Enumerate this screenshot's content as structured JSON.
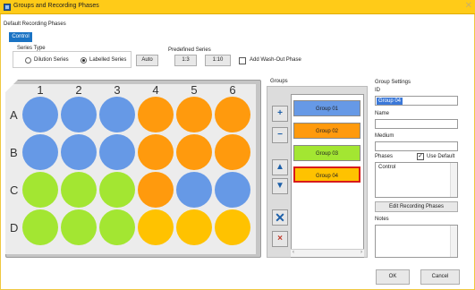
{
  "window": {
    "title": "Groups and Recording Phases",
    "close_glyph": "✕"
  },
  "header": {
    "section_label": "Default Recording Phases",
    "control_tab": "Control"
  },
  "series_type": {
    "title": "Series Type",
    "options": [
      {
        "label": "Dilution Series",
        "selected": false
      },
      {
        "label": "Labelled Series",
        "selected": true
      }
    ],
    "auto_label": "Auto"
  },
  "predefined_series": {
    "title": "Predefined Series",
    "options": [
      "1:3",
      "1:10"
    ]
  },
  "wash_out": {
    "label": "Add Wash-Out Phase",
    "checked": false
  },
  "plate": {
    "columns": [
      "1",
      "2",
      "3",
      "4",
      "5",
      "6"
    ],
    "rows": [
      {
        "label": "A",
        "wells": [
          "#6699e6",
          "#6699e6",
          "#6699e6",
          "#ff9a0d",
          "#ff9a0d",
          "#ff9a0d"
        ]
      },
      {
        "label": "B",
        "wells": [
          "#6699e6",
          "#6699e6",
          "#6699e6",
          "#ff9a0d",
          "#ff9a0d",
          "#ff9a0d"
        ]
      },
      {
        "label": "C",
        "wells": [
          "#a3e632",
          "#a3e632",
          "#a3e632",
          "#ff9a0d",
          "#6699e6",
          "#6699e6"
        ]
      },
      {
        "label": "D",
        "wells": [
          "#a3e632",
          "#a3e632",
          "#a3e632",
          "#ffc200",
          "#ffc200",
          "#ffc200"
        ]
      }
    ]
  },
  "groups": {
    "title": "Groups",
    "items": [
      {
        "label": "Group 01",
        "color": "#6699e6",
        "selected": false
      },
      {
        "label": "Group 02",
        "color": "#ff9a0d",
        "selected": false
      },
      {
        "label": "Group 03",
        "color": "#a3e632",
        "selected": false
      },
      {
        "label": "Group 04",
        "color": "#ffc200",
        "selected": true
      }
    ],
    "tools": [
      "add-group-icon",
      "remove-group-icon",
      "move-up-icon",
      "move-down-icon",
      "clear-wells-icon",
      "delete-group-icon"
    ]
  },
  "group_settings": {
    "title": "Group Settings",
    "id_label": "ID",
    "id_value": "Group 04",
    "name_label": "Name",
    "name_value": "",
    "medium_label": "Medium",
    "medium_value": "",
    "phases_label": "Phases",
    "use_default_label": "Use Default",
    "use_default_checked": true,
    "phases_value": "Control",
    "edit_phases_label": "Edit Recording Phases",
    "notes_label": "Notes",
    "notes_value": ""
  },
  "footer": {
    "ok_label": "OK",
    "cancel_label": "Cancel"
  }
}
